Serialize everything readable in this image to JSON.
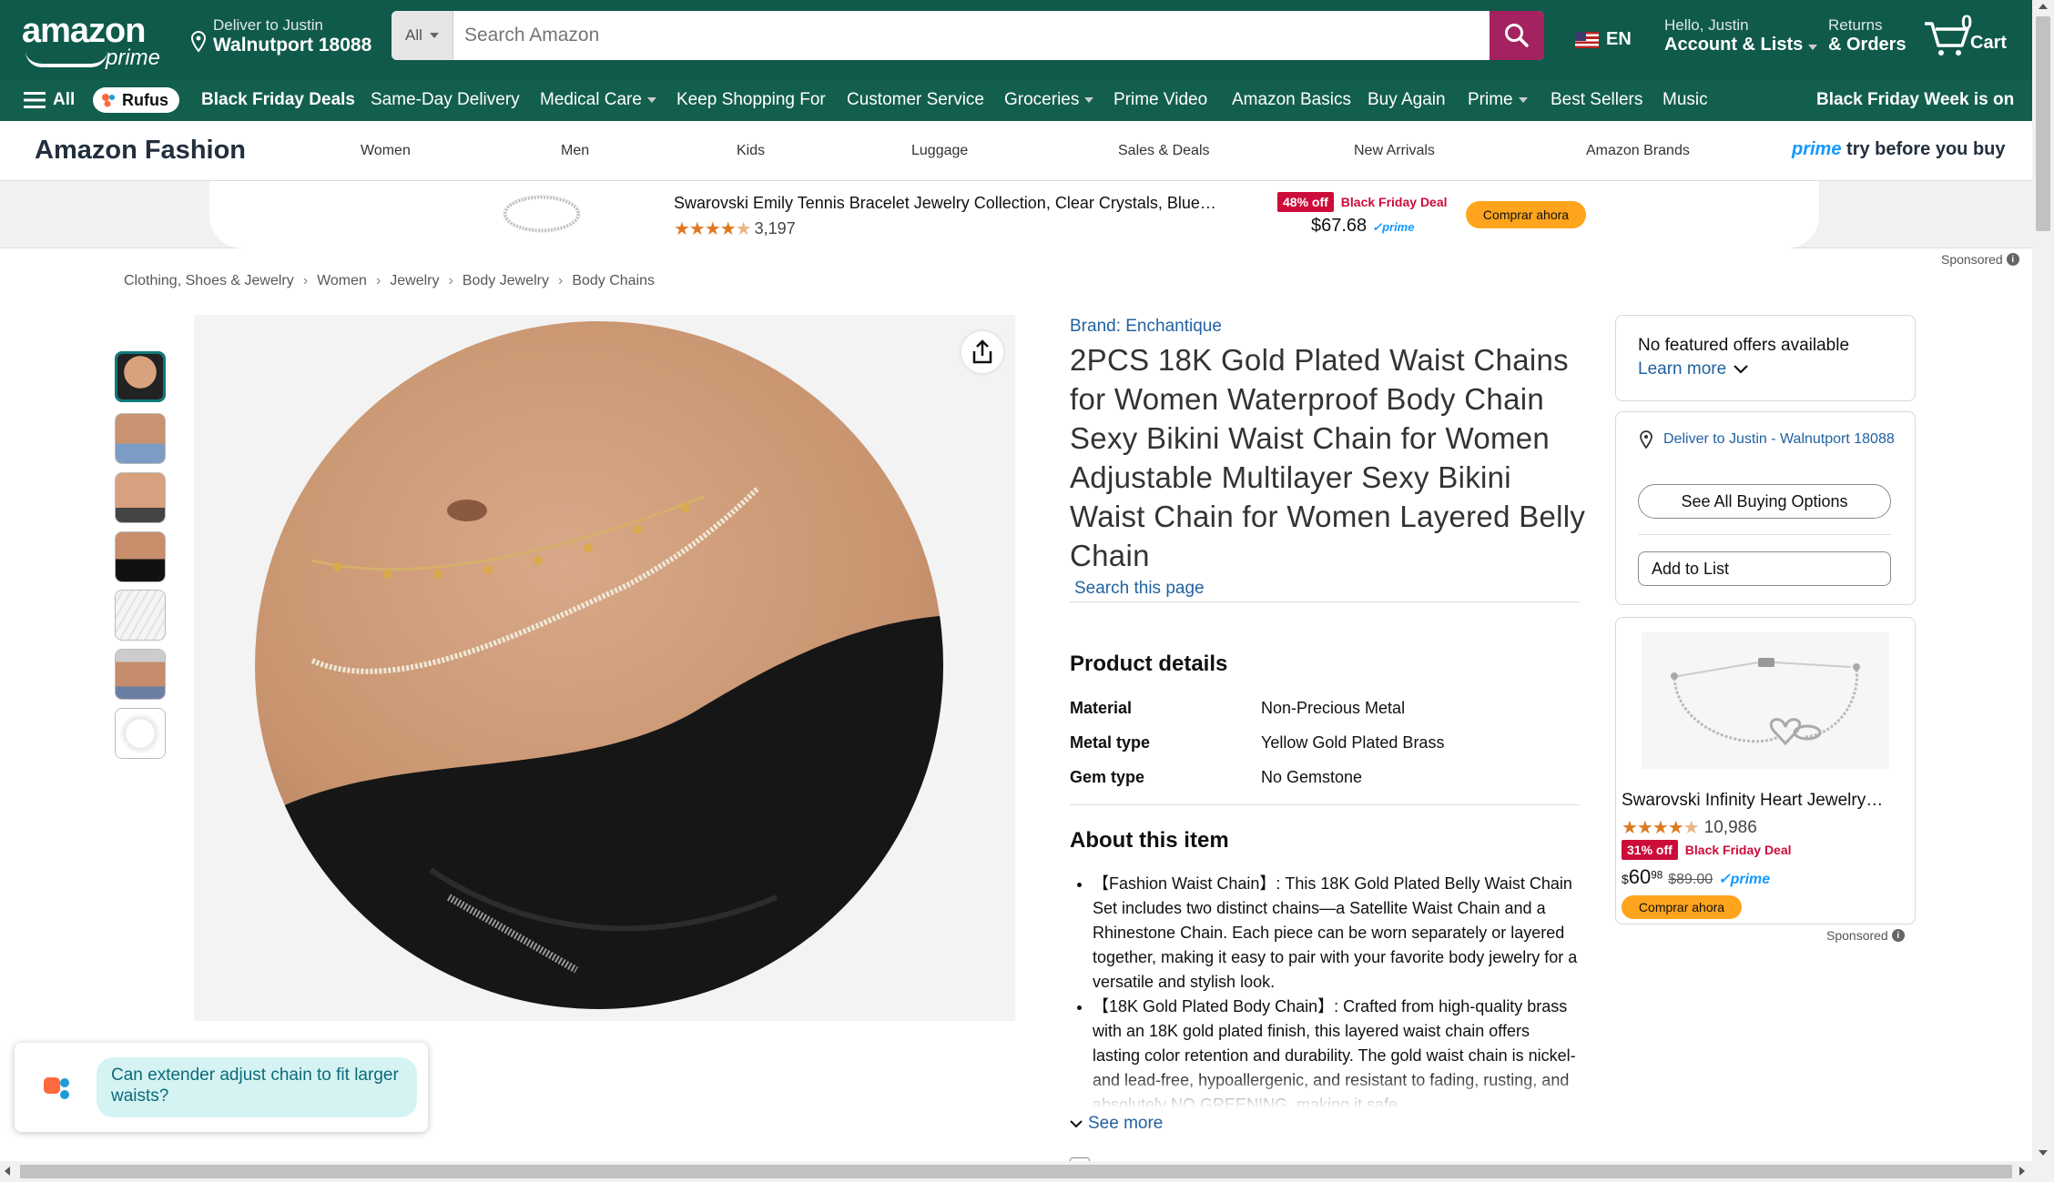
{
  "header": {
    "logo_text": "amazon",
    "logo_sub": "prime",
    "deliver_line1": "Deliver to Justin",
    "deliver_line2": "Walnutport 18088",
    "search_category": "All",
    "search_placeholder": "Search Amazon",
    "language": "EN",
    "account_line1": "Hello, Justin",
    "account_line2": "Account & Lists",
    "orders_line1": "Returns",
    "orders_line2": "& Orders",
    "cart_count": "0",
    "cart_label": "Cart"
  },
  "navbar": {
    "all": "All",
    "rufus": "Rufus",
    "items": [
      {
        "label": "Black Friday Deals"
      },
      {
        "label": "Same-Day Delivery"
      },
      {
        "label": "Medical Care"
      },
      {
        "label": "Keep Shopping For"
      },
      {
        "label": "Customer Service"
      },
      {
        "label": "Groceries"
      },
      {
        "label": "Prime Video"
      },
      {
        "label": "Amazon Basics"
      },
      {
        "label": "Buy Again"
      },
      {
        "label": "Prime"
      },
      {
        "label": "Best Sellers"
      },
      {
        "label": "Music"
      }
    ],
    "promo": "Black Friday Week is on"
  },
  "fashion_nav": {
    "title": "Amazon Fashion",
    "links": [
      "Women",
      "Men",
      "Kids",
      "Luggage",
      "Sales & Deals",
      "New Arrivals",
      "Amazon Brands"
    ],
    "promo_prime": "prime",
    "promo_rest": "try before you buy"
  },
  "ad_banner": {
    "title": "Swarovski Emily Tennis Bracelet Jewelry Collection, Clear Crystals, Blue…",
    "rating": 4.5,
    "review_count": "3,197",
    "discount": "48% off",
    "deal_label": "Black Friday Deal",
    "price": "$67.68",
    "prime": "✓prime",
    "cta": "Comprar ahora",
    "sponsored": "Sponsored"
  },
  "breadcrumb": [
    "Clothing, Shoes & Jewelry",
    "Women",
    "Jewelry",
    "Body Jewelry",
    "Body Chains"
  ],
  "product": {
    "brand": "Brand: Enchantique",
    "title": "2PCS 18K Gold Plated Waist Chains for Women Waterproof Body Chain Sexy Bikini Waist Chain for Women Adjustable Multilayer Sexy Bikini Waist Chain for Women Layered Belly Chain",
    "search_page": "Search this page",
    "details_heading": "Product details",
    "details": [
      {
        "key": "Material",
        "value": "Non-Precious Metal"
      },
      {
        "key": "Metal type",
        "value": "Yellow Gold Plated Brass"
      },
      {
        "key": "Gem type",
        "value": "No Gemstone"
      }
    ],
    "about_heading": "About this item",
    "about": [
      "【Fashion Waist Chain】: This 18K Gold Plated Belly Waist Chain Set includes two distinct chains—a Satellite Waist Chain and a Rhinestone Chain. Each piece can be worn separately or layered together, making it easy to pair with your favorite body jewelry for a versatile and stylish look.",
      "【18K Gold Plated Body Chain】: Crafted from high-quality brass with an 18K gold plated finish, this layered waist chain offers lasting color retention and durability. The gold waist chain is nickel- and lead-free, hypoallergenic, and resistant to fading, rusting, and absolutely NO GREENING, making it safe"
    ],
    "see_more": "See more",
    "thumbnail_count": 7
  },
  "buy_box": {
    "no_offers": "No featured offers available",
    "learn_more": "Learn more",
    "deliver_to": "Deliver to Justin - Walnutport 18088",
    "see_all": "See All Buying Options",
    "add_to_list": "Add to List"
  },
  "side_ad": {
    "title": "Swarovski Infinity Heart Jewelry…",
    "rating": 4.5,
    "review_count": "10,986",
    "discount": "31% off",
    "deal_label": "Black Friday Deal",
    "price_dollars": "60",
    "price_cents": "98",
    "price_currency": "$",
    "list_price": "$89.00",
    "prime": "✓prime",
    "cta": "Comprar ahora",
    "sponsored": "Sponsored"
  },
  "rufus_prompt": "Can extender adjust chain to fit larger waists?",
  "colors": {
    "nav_top": "#0f5a4a",
    "nav_bottom": "#135f4e",
    "search_button": "#a3225f",
    "deal_red": "#cc0c39",
    "buy_button": "#ffa41c",
    "link_blue": "#2162a1"
  }
}
